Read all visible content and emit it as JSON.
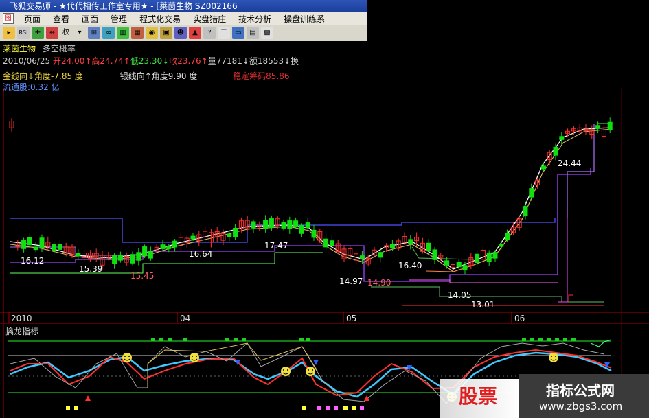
{
  "window": {
    "title": "飞狐交易师 - ★代代相传工作室专用★ - [莱茵生物 SZ002166"
  },
  "menu": [
    "页面",
    "查看",
    "画面",
    "管理",
    "程式化交易",
    "实盘猎庄",
    "技术分析",
    "操盘训练系"
  ],
  "toolbar": {
    "rights_label": "权"
  },
  "stock": {
    "name": "莱茵生物",
    "indicator": "多空概率",
    "date": "2010/06/25",
    "open": "开24.00↑",
    "high": "高24.74↑",
    "low": "低23.30↓",
    "close": "收23.76↑",
    "volume": "量77181↓",
    "amount": "额18553↓",
    "amount_suffix": "换"
  },
  "indicators": {
    "gold_line": "金线向↓角度-7.85 度",
    "silver_line": "银线向↑角度9.90 度",
    "stable_chips": "稳定筹码85.86",
    "float_shares": "流通股:0.32 亿"
  },
  "price_labels": [
    {
      "text": "16.12"
    },
    {
      "text": "15.39"
    },
    {
      "text": "15.45"
    },
    {
      "text": "16.64"
    },
    {
      "text": "17.47"
    },
    {
      "text": "14.97"
    },
    {
      "text": "14.90"
    },
    {
      "text": "16.40"
    },
    {
      "text": "14.05"
    },
    {
      "text": "13.01"
    },
    {
      "text": "24.44"
    }
  ],
  "time_axis": [
    "2010",
    "04",
    "05",
    "06"
  ],
  "lower_panel": {
    "title": "擒龙指标"
  },
  "watermark": {
    "left": "股票",
    "right_title": "指标公式网",
    "right_url": "www.zbgs3.com"
  },
  "colors": {
    "up": "#ff3030",
    "down": "#00e000",
    "panel_border": "#b00000"
  }
}
